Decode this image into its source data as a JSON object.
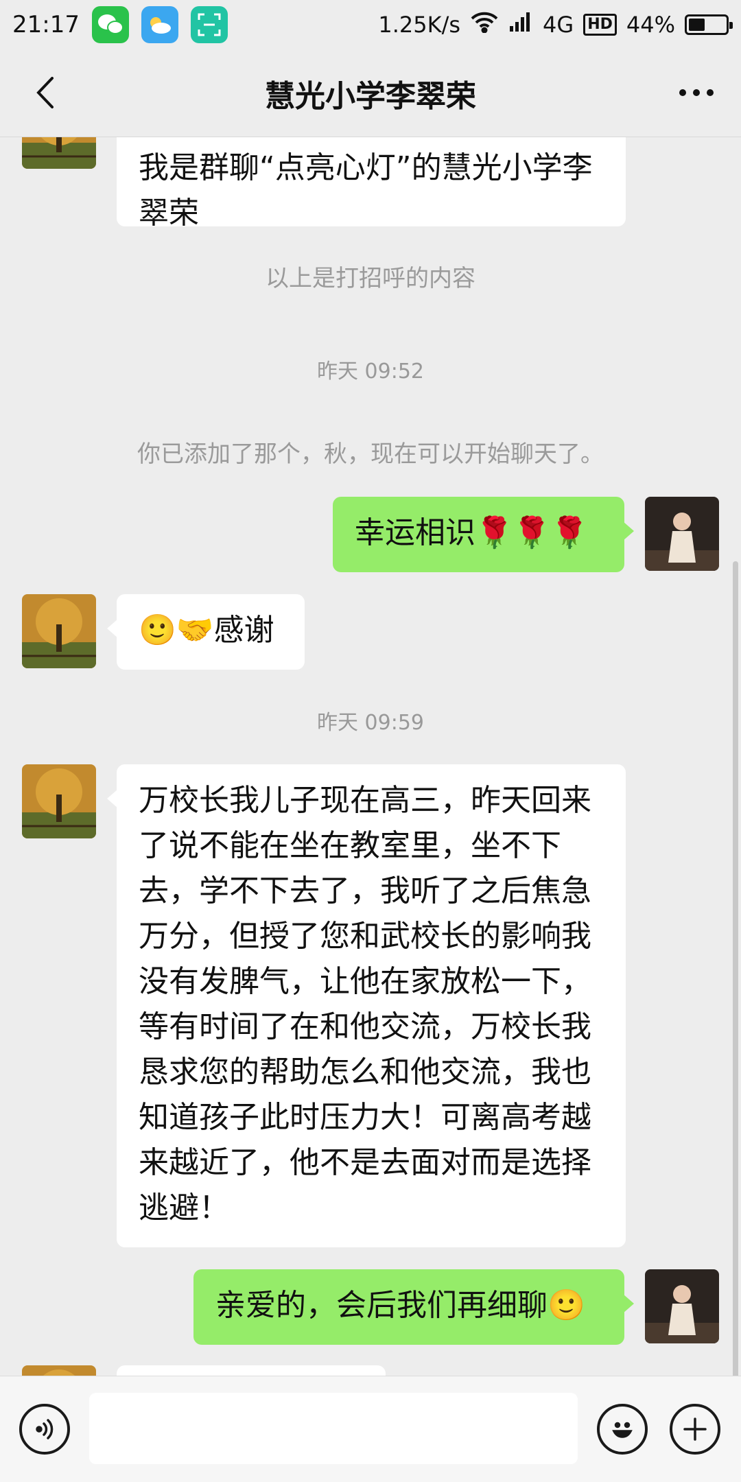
{
  "status_bar": {
    "time": "21:17",
    "network_speed": "1.25K/s",
    "network_type": "4G",
    "hd_label": "HD",
    "battery": "44%",
    "battery_level": 0.44,
    "icons": [
      "wechat-icon",
      "weather-icon",
      "scan-icon",
      "wifi-icon",
      "signal-icon",
      "battery-icon"
    ]
  },
  "nav": {
    "title": "慧光小学李翠荣",
    "back_icon": "chevron-left-icon",
    "more_icon": "more-icon"
  },
  "chat": {
    "greeting_bubble": "我是群聊“点亮心灯”的慧光小学李翠荣",
    "greeting_note": "以上是打招呼的内容",
    "time_1": "昨天 09:52",
    "added_notice": "你已添加了那个，秋，现在可以开始聊天了。",
    "msg_sent_1": "幸运相识🌹🌹🌹",
    "msg_recv_1": "🙂🤝感谢",
    "time_2": "昨天 09:59",
    "msg_recv_2": "万校长我儿子现在高三，昨天回来了说不能在坐在教室里，坐不下去，学不下去了，我听了之后焦急万分，但授了您和武校长的影响我没有发脾气，让他在家放松一下，等有时间了在和他交流，万校长我恳求您的帮助怎么和他交流，我也知道孩子此时压力大！可离高考越来越近了，他不是去面对而是选择逃避！",
    "msg_sent_2": "亲爱的，会后我们再细聊🙂"
  },
  "input_bar": {
    "voice_icon": "voice-icon",
    "emoji_icon": "emoji-icon",
    "plus_icon": "plus-icon",
    "placeholder": ""
  },
  "colors": {
    "background": "#ededed",
    "sent_bubble": "#95ec69",
    "received_bubble": "#ffffff"
  }
}
